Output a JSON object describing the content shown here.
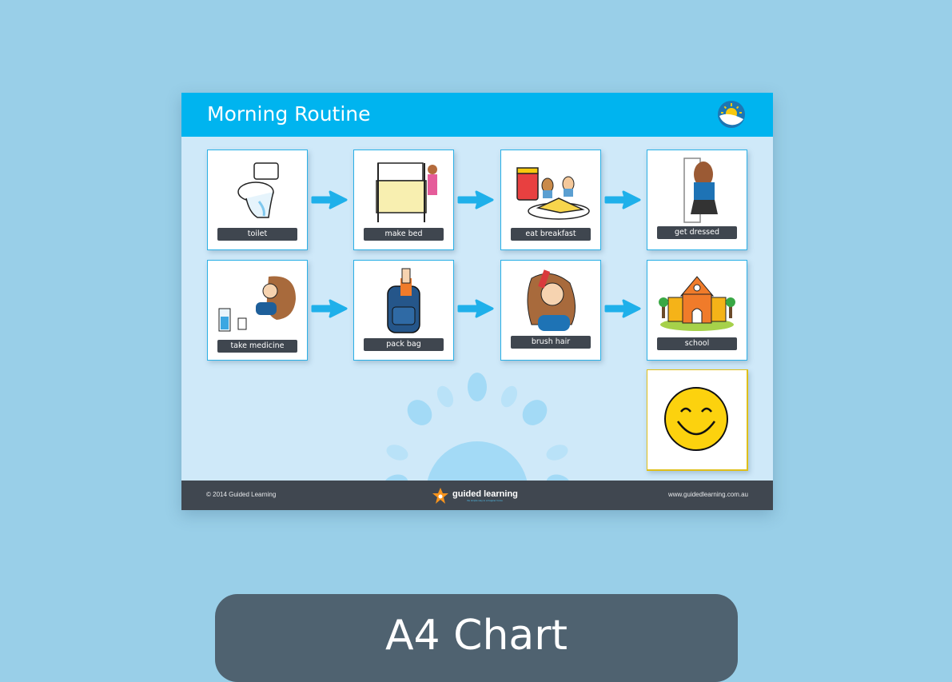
{
  "chart": {
    "title": "Morning Routine",
    "header_icon": "sunrise-icon",
    "steps": [
      {
        "label": "toilet",
        "icon": "toilet-icon"
      },
      {
        "label": "make bed",
        "icon": "bed-icon"
      },
      {
        "label": "eat breakfast",
        "icon": "breakfast-icon"
      },
      {
        "label": "get dressed",
        "icon": "dressing-icon"
      },
      {
        "label": "take medicine",
        "icon": "medicine-icon"
      },
      {
        "label": "pack bag",
        "icon": "backpack-icon"
      },
      {
        "label": "brush hair",
        "icon": "hairbrush-icon"
      },
      {
        "label": "school",
        "icon": "school-icon"
      }
    ],
    "reward_icon": "smiley-face-icon",
    "footer": {
      "copyright": "© 2014 Guided Learning",
      "brand": "guided learning",
      "tagline": "the simple way to a happier home",
      "website": "www.guidedlearning.com.au"
    }
  },
  "banner": {
    "label": "A4 Chart"
  },
  "colors": {
    "header": "#00b4ef",
    "footer": "#404750",
    "sheet": "#cfe9f9",
    "background": "#99cfe8",
    "banner": "#4f6270"
  }
}
